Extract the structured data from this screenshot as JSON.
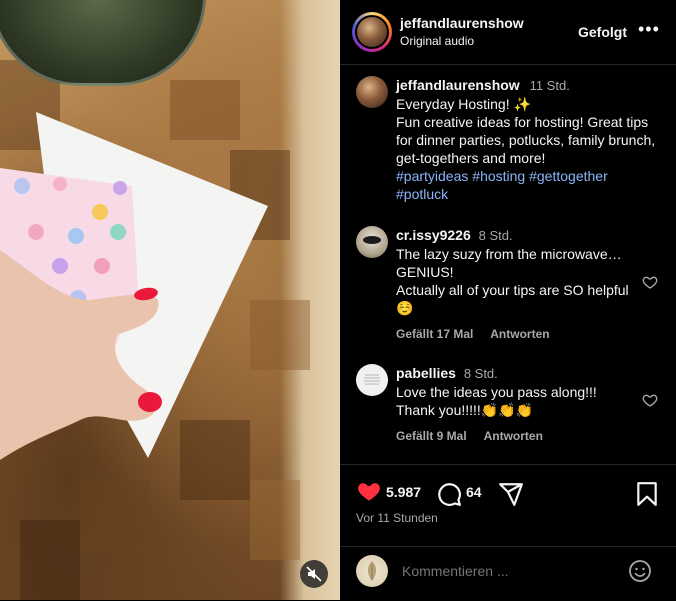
{
  "header": {
    "username": "jeffandlaurenshow",
    "audio": "Original audio",
    "follow_label": "Gefolgt",
    "more_label": "•••"
  },
  "caption": {
    "username": "jeffandlaurenshow",
    "time": "11 Std.",
    "title": "Everyday Hosting! ✨",
    "body": "Fun creative ideas for hosting! Great tips for dinner parties, potlucks, family brunch, get-togethers and more!",
    "hashtags": [
      "#partyideas",
      "#hosting",
      "#gettogether",
      "#potluck"
    ]
  },
  "comments": [
    {
      "username": "cr.issy9226",
      "time": "8 Std.",
      "text_line1": "The lazy suzy from the microwave… GENIUS!",
      "text_line2": "Actually all of your tips are SO helpful ☺️",
      "likes": "Gefällt 17 Mal",
      "reply_label": "Antworten"
    },
    {
      "username": "pabellies",
      "time": "8 Std.",
      "text_line1": "Love the ideas you pass along!!! Thank you!!!!!👏👏👏",
      "likes": "Gefällt 9 Mal",
      "reply_label": "Antworten"
    }
  ],
  "actions": {
    "likes_count": "5.987",
    "comments_count": "64",
    "time_ago": "Vor 11 Stunden"
  },
  "add_comment": {
    "placeholder": "Kommentieren ..."
  },
  "colors": {
    "background": "#000000",
    "text": "#f5f5f5",
    "muted": "#a8a8a8",
    "hashtag": "#8ab4f8",
    "like_red": "#ff3040"
  }
}
